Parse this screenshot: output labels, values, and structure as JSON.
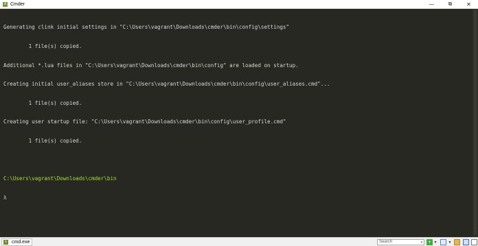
{
  "window": {
    "title": "Cmder",
    "app_icon": "λ",
    "minimize_glyph": "—",
    "maximize_glyph": "⧉",
    "close_glyph": "✕"
  },
  "console": {
    "lines": [
      "Generating clink initial settings in \"C:\\Users\\vagrant\\Downloads\\cmder\\bin\\config\\settings\"",
      "        1 file(s) copied.",
      "Additional *.lua files in \"C:\\Users\\vagrant\\Downloads\\cmder\\bin\\config\" are loaded on startup.",
      "Creating initial user_aliases store in \"C:\\Users\\vagrant\\Downloads\\cmder\\bin\\config\\user_aliases.cmd\"...",
      "        1 file(s) copied.",
      "Creating user startup file: \"C:\\Users\\vagrant\\Downloads\\cmder\\bin\\config\\user_profile.cmd\"",
      "        1 file(s) copied.",
      ""
    ],
    "prompt_path": "C:\\Users\\vagrant\\Downloads\\cmder\\bin",
    "prompt_symbol": "λ",
    "colors": {
      "background": "#272822",
      "text": "#d7d7d7",
      "prompt": "#a6e22e"
    }
  },
  "statusbar": {
    "tab_label": "cmd.exe",
    "tab_icon": "λ",
    "search_placeholder": "Search",
    "icons": [
      "search-icon",
      "new-console-icon",
      "dropdown-icon",
      "layout-icon",
      "dropdown-icon",
      "lock-icon",
      "window-mode-icon",
      "menu-icon"
    ]
  }
}
